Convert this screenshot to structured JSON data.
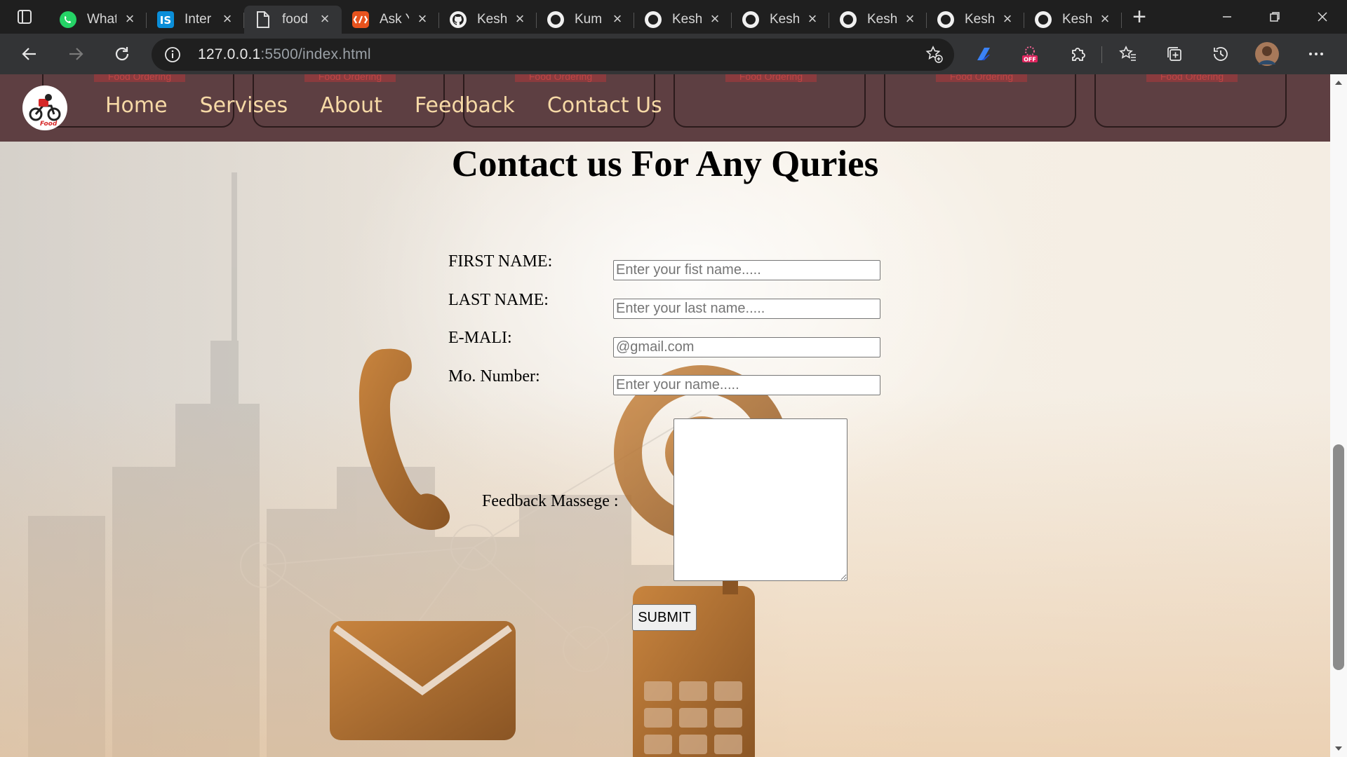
{
  "browser": {
    "tabs": [
      {
        "title": "What",
        "icon": "whatsapp-icon",
        "active": false
      },
      {
        "title": "Inter",
        "icon": "internshala-icon",
        "active": false
      },
      {
        "title": "food",
        "icon": "file-icon",
        "active": true
      },
      {
        "title": "Ask Y",
        "icon": "html-icon",
        "active": false
      },
      {
        "title": "Kesh",
        "icon": "github-icon",
        "active": false
      },
      {
        "title": "Kum",
        "icon": "github-icon",
        "active": false
      },
      {
        "title": "Kesh",
        "icon": "github-icon",
        "active": false
      },
      {
        "title": "Kesh",
        "icon": "github-icon",
        "active": false
      },
      {
        "title": "Kesh",
        "icon": "github-icon",
        "active": false
      },
      {
        "title": "Kesh",
        "icon": "github-icon",
        "active": false
      },
      {
        "title": "Kesh",
        "icon": "github-icon",
        "active": false
      }
    ],
    "address": {
      "host": "127.0.0.1",
      "path": ":5500/index.html"
    },
    "colors": {
      "tabstrip": "#1f1f1f",
      "toolbar": "#333436"
    }
  },
  "site": {
    "nav_card_label": "Food Ordering",
    "nav": {
      "home": "Home",
      "services": "Servises",
      "about": "About",
      "feedback": "Feedback",
      "contact": "Contact Us"
    },
    "colors": {
      "navbar": "#5e3f42",
      "nav_text": "#f6d9a6"
    }
  },
  "form": {
    "title": "Contact us For Any Quries",
    "first_name_label": "FIRST NAME:",
    "first_name_placeholder": "Enter your fist name.....",
    "last_name_label": "LAST NAME:",
    "last_name_placeholder": "Enter your last name.....",
    "email_label": "E-MALI:",
    "email_placeholder": "@gmail.com",
    "mobile_label": "Mo. Number:",
    "mobile_placeholder": "Enter your name.....",
    "feedback_label": "Feedback Massege :",
    "submit_label": "SUBMIT"
  }
}
